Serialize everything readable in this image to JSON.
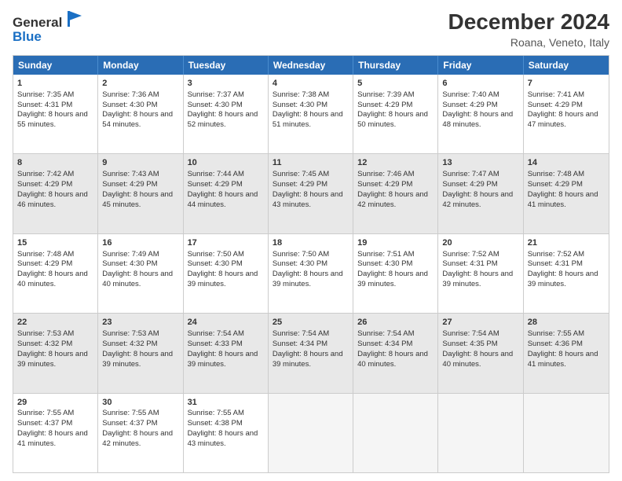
{
  "header": {
    "logo_general": "General",
    "logo_blue": "Blue",
    "title": "December 2024",
    "subtitle": "Roana, Veneto, Italy"
  },
  "days_of_week": [
    "Sunday",
    "Monday",
    "Tuesday",
    "Wednesday",
    "Thursday",
    "Friday",
    "Saturday"
  ],
  "weeks": [
    [
      {
        "day": "1",
        "sunrise": "Sunrise: 7:35 AM",
        "sunset": "Sunset: 4:31 PM",
        "daylight": "Daylight: 8 hours and 55 minutes.",
        "shaded": false,
        "empty": false
      },
      {
        "day": "2",
        "sunrise": "Sunrise: 7:36 AM",
        "sunset": "Sunset: 4:30 PM",
        "daylight": "Daylight: 8 hours and 54 minutes.",
        "shaded": false,
        "empty": false
      },
      {
        "day": "3",
        "sunrise": "Sunrise: 7:37 AM",
        "sunset": "Sunset: 4:30 PM",
        "daylight": "Daylight: 8 hours and 52 minutes.",
        "shaded": false,
        "empty": false
      },
      {
        "day": "4",
        "sunrise": "Sunrise: 7:38 AM",
        "sunset": "Sunset: 4:30 PM",
        "daylight": "Daylight: 8 hours and 51 minutes.",
        "shaded": false,
        "empty": false
      },
      {
        "day": "5",
        "sunrise": "Sunrise: 7:39 AM",
        "sunset": "Sunset: 4:29 PM",
        "daylight": "Daylight: 8 hours and 50 minutes.",
        "shaded": false,
        "empty": false
      },
      {
        "day": "6",
        "sunrise": "Sunrise: 7:40 AM",
        "sunset": "Sunset: 4:29 PM",
        "daylight": "Daylight: 8 hours and 48 minutes.",
        "shaded": false,
        "empty": false
      },
      {
        "day": "7",
        "sunrise": "Sunrise: 7:41 AM",
        "sunset": "Sunset: 4:29 PM",
        "daylight": "Daylight: 8 hours and 47 minutes.",
        "shaded": false,
        "empty": false
      }
    ],
    [
      {
        "day": "8",
        "sunrise": "Sunrise: 7:42 AM",
        "sunset": "Sunset: 4:29 PM",
        "daylight": "Daylight: 8 hours and 46 minutes.",
        "shaded": true,
        "empty": false
      },
      {
        "day": "9",
        "sunrise": "Sunrise: 7:43 AM",
        "sunset": "Sunset: 4:29 PM",
        "daylight": "Daylight: 8 hours and 45 minutes.",
        "shaded": true,
        "empty": false
      },
      {
        "day": "10",
        "sunrise": "Sunrise: 7:44 AM",
        "sunset": "Sunset: 4:29 PM",
        "daylight": "Daylight: 8 hours and 44 minutes.",
        "shaded": true,
        "empty": false
      },
      {
        "day": "11",
        "sunrise": "Sunrise: 7:45 AM",
        "sunset": "Sunset: 4:29 PM",
        "daylight": "Daylight: 8 hours and 43 minutes.",
        "shaded": true,
        "empty": false
      },
      {
        "day": "12",
        "sunrise": "Sunrise: 7:46 AM",
        "sunset": "Sunset: 4:29 PM",
        "daylight": "Daylight: 8 hours and 42 minutes.",
        "shaded": true,
        "empty": false
      },
      {
        "day": "13",
        "sunrise": "Sunrise: 7:47 AM",
        "sunset": "Sunset: 4:29 PM",
        "daylight": "Daylight: 8 hours and 42 minutes.",
        "shaded": true,
        "empty": false
      },
      {
        "day": "14",
        "sunrise": "Sunrise: 7:48 AM",
        "sunset": "Sunset: 4:29 PM",
        "daylight": "Daylight: 8 hours and 41 minutes.",
        "shaded": true,
        "empty": false
      }
    ],
    [
      {
        "day": "15",
        "sunrise": "Sunrise: 7:48 AM",
        "sunset": "Sunset: 4:29 PM",
        "daylight": "Daylight: 8 hours and 40 minutes.",
        "shaded": false,
        "empty": false
      },
      {
        "day": "16",
        "sunrise": "Sunrise: 7:49 AM",
        "sunset": "Sunset: 4:30 PM",
        "daylight": "Daylight: 8 hours and 40 minutes.",
        "shaded": false,
        "empty": false
      },
      {
        "day": "17",
        "sunrise": "Sunrise: 7:50 AM",
        "sunset": "Sunset: 4:30 PM",
        "daylight": "Daylight: 8 hours and 39 minutes.",
        "shaded": false,
        "empty": false
      },
      {
        "day": "18",
        "sunrise": "Sunrise: 7:50 AM",
        "sunset": "Sunset: 4:30 PM",
        "daylight": "Daylight: 8 hours and 39 minutes.",
        "shaded": false,
        "empty": false
      },
      {
        "day": "19",
        "sunrise": "Sunrise: 7:51 AM",
        "sunset": "Sunset: 4:30 PM",
        "daylight": "Daylight: 8 hours and 39 minutes.",
        "shaded": false,
        "empty": false
      },
      {
        "day": "20",
        "sunrise": "Sunrise: 7:52 AM",
        "sunset": "Sunset: 4:31 PM",
        "daylight": "Daylight: 8 hours and 39 minutes.",
        "shaded": false,
        "empty": false
      },
      {
        "day": "21",
        "sunrise": "Sunrise: 7:52 AM",
        "sunset": "Sunset: 4:31 PM",
        "daylight": "Daylight: 8 hours and 39 minutes.",
        "shaded": false,
        "empty": false
      }
    ],
    [
      {
        "day": "22",
        "sunrise": "Sunrise: 7:53 AM",
        "sunset": "Sunset: 4:32 PM",
        "daylight": "Daylight: 8 hours and 39 minutes.",
        "shaded": true,
        "empty": false
      },
      {
        "day": "23",
        "sunrise": "Sunrise: 7:53 AM",
        "sunset": "Sunset: 4:32 PM",
        "daylight": "Daylight: 8 hours and 39 minutes.",
        "shaded": true,
        "empty": false
      },
      {
        "day": "24",
        "sunrise": "Sunrise: 7:54 AM",
        "sunset": "Sunset: 4:33 PM",
        "daylight": "Daylight: 8 hours and 39 minutes.",
        "shaded": true,
        "empty": false
      },
      {
        "day": "25",
        "sunrise": "Sunrise: 7:54 AM",
        "sunset": "Sunset: 4:34 PM",
        "daylight": "Daylight: 8 hours and 39 minutes.",
        "shaded": true,
        "empty": false
      },
      {
        "day": "26",
        "sunrise": "Sunrise: 7:54 AM",
        "sunset": "Sunset: 4:34 PM",
        "daylight": "Daylight: 8 hours and 40 minutes.",
        "shaded": true,
        "empty": false
      },
      {
        "day": "27",
        "sunrise": "Sunrise: 7:54 AM",
        "sunset": "Sunset: 4:35 PM",
        "daylight": "Daylight: 8 hours and 40 minutes.",
        "shaded": true,
        "empty": false
      },
      {
        "day": "28",
        "sunrise": "Sunrise: 7:55 AM",
        "sunset": "Sunset: 4:36 PM",
        "daylight": "Daylight: 8 hours and 41 minutes.",
        "shaded": true,
        "empty": false
      }
    ],
    [
      {
        "day": "29",
        "sunrise": "Sunrise: 7:55 AM",
        "sunset": "Sunset: 4:37 PM",
        "daylight": "Daylight: 8 hours and 41 minutes.",
        "shaded": false,
        "empty": false
      },
      {
        "day": "30",
        "sunrise": "Sunrise: 7:55 AM",
        "sunset": "Sunset: 4:37 PM",
        "daylight": "Daylight: 8 hours and 42 minutes.",
        "shaded": false,
        "empty": false
      },
      {
        "day": "31",
        "sunrise": "Sunrise: 7:55 AM",
        "sunset": "Sunset: 4:38 PM",
        "daylight": "Daylight: 8 hours and 43 minutes.",
        "shaded": false,
        "empty": false
      },
      {
        "day": "",
        "sunrise": "",
        "sunset": "",
        "daylight": "",
        "shaded": false,
        "empty": true
      },
      {
        "day": "",
        "sunrise": "",
        "sunset": "",
        "daylight": "",
        "shaded": false,
        "empty": true
      },
      {
        "day": "",
        "sunrise": "",
        "sunset": "",
        "daylight": "",
        "shaded": false,
        "empty": true
      },
      {
        "day": "",
        "sunrise": "",
        "sunset": "",
        "daylight": "",
        "shaded": false,
        "empty": true
      }
    ]
  ]
}
